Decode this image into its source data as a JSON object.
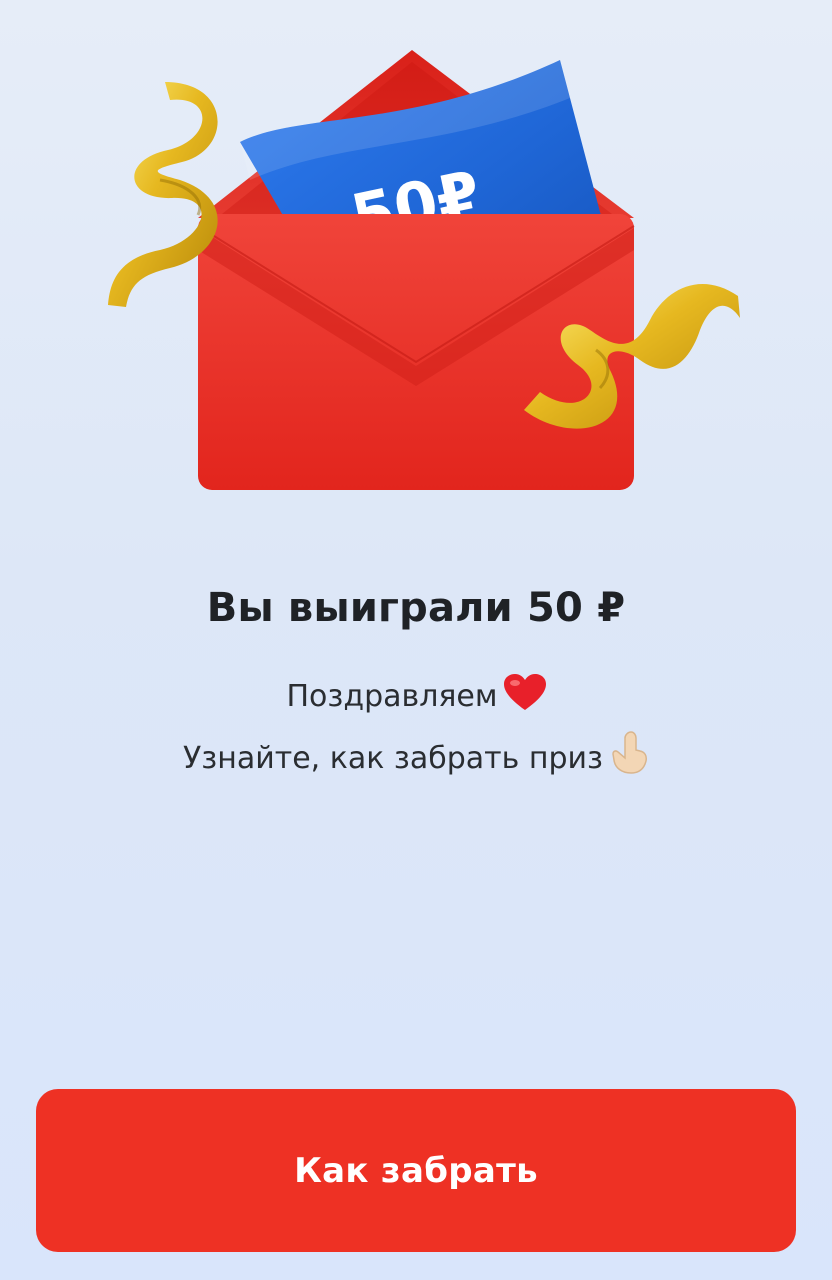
{
  "prize": {
    "banner_text": "50₽",
    "title": "Вы выиграли 50 ₽",
    "subtitle_line1": "Поздравляем",
    "subtitle_line2": "Узнайте, как забрать приз"
  },
  "icons": {
    "line1_emoji": "heart-icon",
    "line2_emoji": "pointing-hand-icon"
  },
  "actions": {
    "primary_label": "Как забрать"
  },
  "colors": {
    "accent": "#ee3124",
    "envelope": "#e8332a",
    "banner": "#1f66d6",
    "ribbon": "#e6b820",
    "text": "#1f2226"
  }
}
